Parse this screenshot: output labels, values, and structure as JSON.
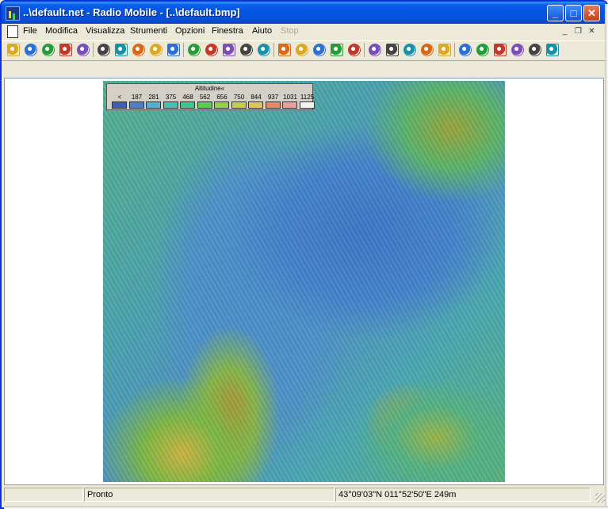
{
  "window": {
    "title": "..\\default.net - Radio Mobile - [..\\default.bmp]"
  },
  "controls": {
    "minimize": "_",
    "maximize": "□",
    "close": "✕",
    "mdi_minimize": "_",
    "mdi_restore": "❐",
    "mdi_close": "✕"
  },
  "menu": [
    {
      "label": "File",
      "enabled": true
    },
    {
      "label": "Modifica",
      "enabled": true
    },
    {
      "label": "Visualizza",
      "enabled": true
    },
    {
      "label": "Strumenti",
      "enabled": true
    },
    {
      "label": "Opzioni",
      "enabled": true
    },
    {
      "label": "Finestra",
      "enabled": true
    },
    {
      "label": "Aiuto",
      "enabled": true
    },
    {
      "label": "Stop",
      "enabled": false
    }
  ],
  "toolbar_icons": [
    "new-icon",
    "open-icon",
    "open-network-icon",
    "network-properties-icon",
    "unit-properties-icon",
    "globe-icon",
    "map-properties-icon",
    "map-extract-icon",
    "first-icon",
    "last-icon",
    "copy-map-icon",
    "paste-map-icon",
    "save-picture-icon",
    "export-icon",
    "print-icon",
    "copy-icon",
    "paste-icon",
    "elevation-icon",
    "grayscale-icon",
    "ruler-icon",
    "fit-icon",
    "window-icon",
    "person-icon",
    "frame-icon",
    "radio-link-icon",
    "green-circle-icon",
    "coverage-icon",
    "polar-plot-icon",
    "network-icon",
    "device-icon",
    "world-icon"
  ],
  "legend": {
    "title": "Altitudine«",
    "labels": [
      "<",
      "187",
      "281",
      "375",
      "468",
      "562",
      "656",
      "750",
      "844",
      "937",
      "1031",
      "1125"
    ],
    "colors": [
      "#3f5fb3",
      "#4b7fd0",
      "#4cb0d7",
      "#45c0b4",
      "#3ec78b",
      "#5ccd54",
      "#94d04a",
      "#c7cf4a",
      "#e0c45a",
      "#e58a60",
      "#ed9f94",
      "#f2f2f2"
    ]
  },
  "status": {
    "message": "Pronto",
    "coordinates": "43°09'03\"N 011°52'50\"E 249m"
  }
}
